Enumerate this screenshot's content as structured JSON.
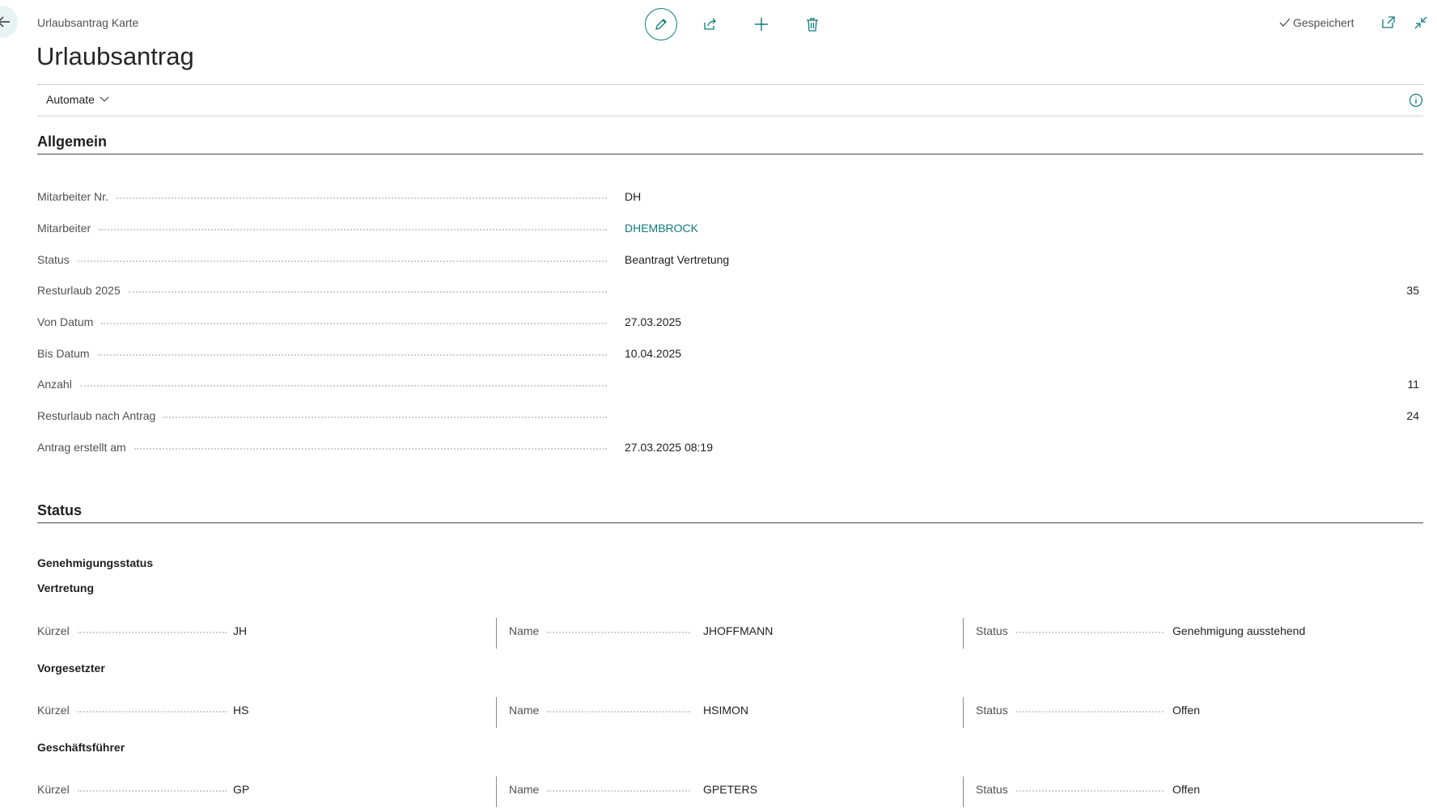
{
  "header": {
    "breadcrumb": "Urlaubsantrag Karte",
    "title": "Urlaubsantrag",
    "saved_label": "Gespeichert"
  },
  "toolbar": {
    "icons": [
      "edit-icon",
      "share-icon",
      "new-icon",
      "delete-icon"
    ]
  },
  "actionbar": {
    "automate_label": "Automate"
  },
  "general": {
    "title": "Allgemein",
    "fields": {
      "mitarbeiter_nr": {
        "label": "Mitarbeiter Nr.",
        "value": "DH"
      },
      "mitarbeiter": {
        "label": "Mitarbeiter",
        "value": "DHEMBROCK"
      },
      "status": {
        "label": "Status",
        "value": "Beantragt Vertretung"
      },
      "resturlaub": {
        "label": "Resturlaub 2025",
        "value": "35"
      },
      "von_datum": {
        "label": "Von Datum",
        "value": "27.03.2025"
      },
      "bis_datum": {
        "label": "Bis Datum",
        "value": "10.04.2025"
      },
      "anzahl": {
        "label": "Anzahl",
        "value": "11"
      },
      "resturlaub_nach": {
        "label": "Resturlaub nach Antrag",
        "value": "24"
      },
      "erstellt_am": {
        "label": "Antrag erstellt am",
        "value": "27.03.2025 08:19"
      }
    }
  },
  "status_section": {
    "title": "Status",
    "subtitle": "Genehmigungsstatus",
    "groups": [
      {
        "title": "Vertretung",
        "kuerzel_label": "Kürzel",
        "kuerzel": "JH",
        "name_label": "Name",
        "name": "JHOFFMANN",
        "status_label": "Status",
        "status": "Genehmigung ausstehend"
      },
      {
        "title": "Vorgesetzter",
        "kuerzel_label": "Kürzel",
        "kuerzel": "HS",
        "name_label": "Name",
        "name": "HSIMON",
        "status_label": "Status",
        "status": "Offen"
      },
      {
        "title": "Geschäftsführer",
        "kuerzel_label": "Kürzel",
        "kuerzel": "GP",
        "name_label": "Name",
        "name": "GPETERS",
        "status_label": "Status",
        "status": "Offen"
      }
    ]
  },
  "colors": {
    "accent": "#0f7b7b",
    "label": "#505050",
    "text": "#212121"
  }
}
